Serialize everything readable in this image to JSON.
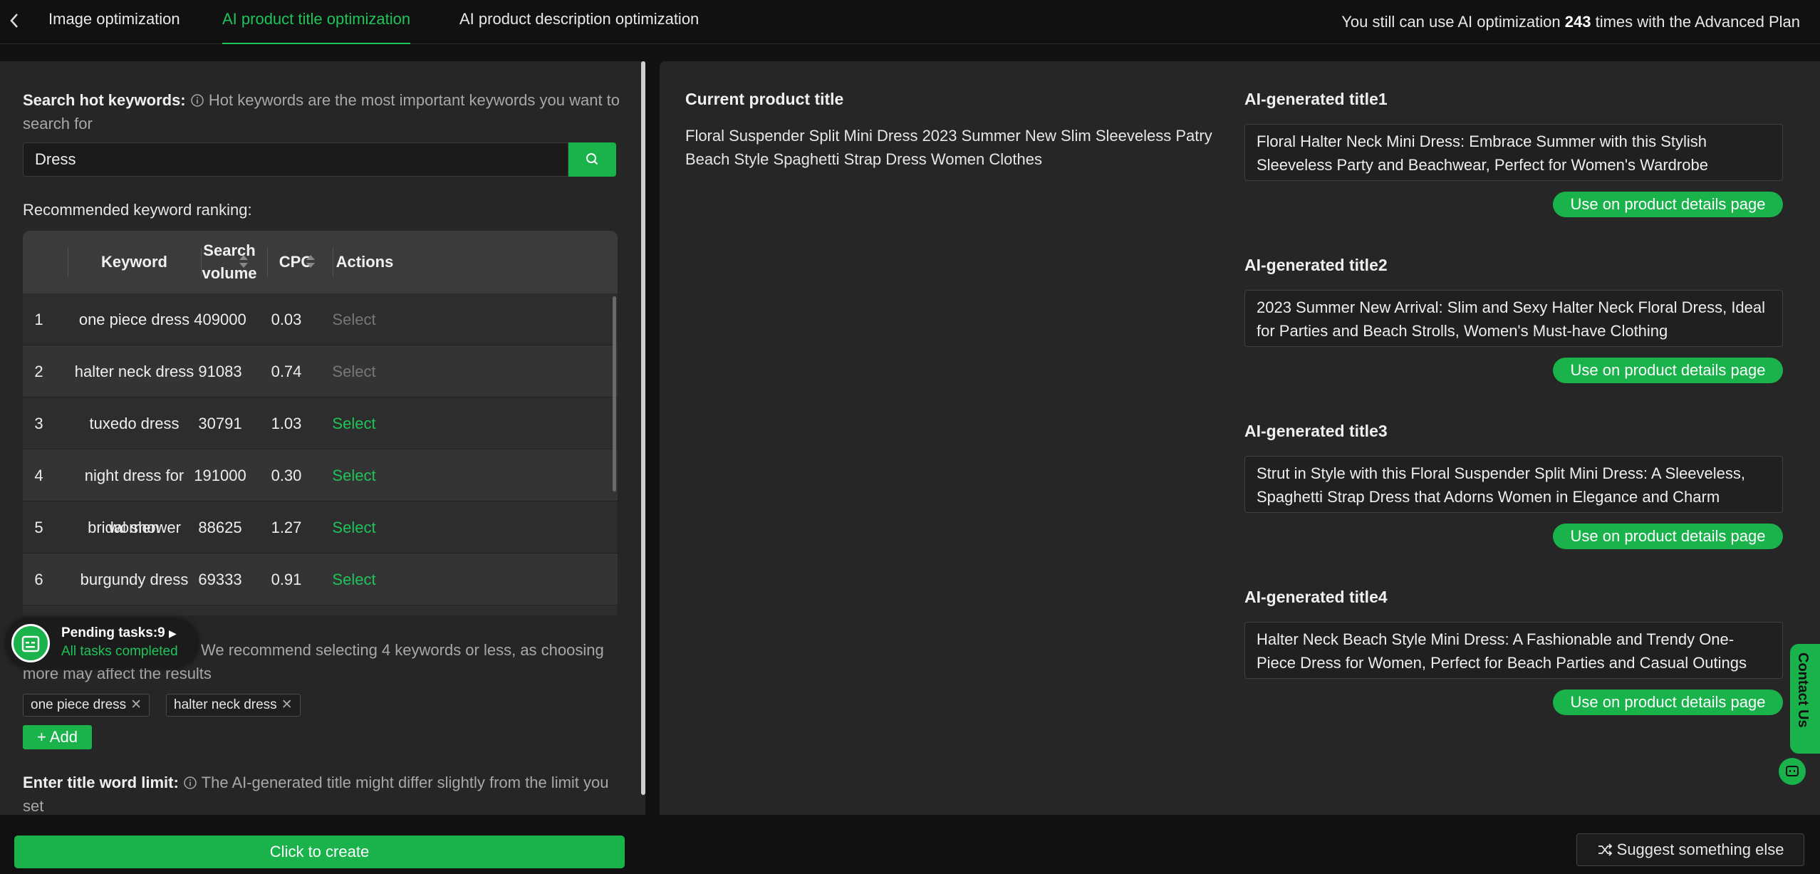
{
  "tabs": [
    {
      "label": "Image optimization"
    },
    {
      "label": "AI product title optimization",
      "active": true
    },
    {
      "label": "AI product description optimization"
    }
  ],
  "quota": {
    "prefix": "You still can use AI optimization",
    "count": "243",
    "suffix": "times with the Advanced Plan"
  },
  "search": {
    "heading": "Search hot keywords:",
    "hint": "Hot keywords are the most important keywords you want to search for",
    "value": "Dress"
  },
  "ranking": {
    "label": "Recommended keyword ranking:",
    "headers": {
      "keyword": "Keyword",
      "volume_line1": "Search",
      "volume_line2": "volume",
      "cpc": "CPC",
      "actions": "Actions"
    },
    "rows": [
      {
        "idx": "1",
        "keyword": "one piece dress",
        "volume": "409000",
        "cpc": "0.03",
        "action": "Select",
        "enabled": false
      },
      {
        "idx": "2",
        "keyword": "halter neck dress",
        "volume": "91083",
        "cpc": "0.74",
        "action": "Select",
        "enabled": false
      },
      {
        "idx": "3",
        "keyword": "tuxedo dress",
        "volume": "30791",
        "cpc": "1.03",
        "action": "Select",
        "enabled": true
      },
      {
        "idx": "4",
        "keyword": "night dress for women",
        "volume": "191000",
        "cpc": "0.30",
        "action": "Select",
        "enabled": true
      },
      {
        "idx": "5",
        "keyword": "bridal shower dress",
        "volume": "88625",
        "cpc": "1.27",
        "action": "Select",
        "enabled": true
      },
      {
        "idx": "6",
        "keyword": "burgundy dress",
        "volume": "69333",
        "cpc": "0.91",
        "action": "Select",
        "enabled": true
      }
    ]
  },
  "pending": {
    "title": "Pending tasks:9",
    "status": "All tasks completed"
  },
  "selection": {
    "note": "We recommend selecting 4 keywords or less, as choosing more may affect the results",
    "chips": [
      "one piece dress",
      "halter neck dress"
    ],
    "add_label": "Add"
  },
  "limit": {
    "heading": "Enter title word limit:",
    "hint": "The AI-generated title might differ slightly from the limit you set"
  },
  "create_label": "Click to create",
  "current": {
    "heading": "Current product title",
    "text": "Floral Suspender Split Mini Dress 2023 Summer New Slim Sleeveless Patry Beach Style Spaghetti Strap Dress Women Clothes"
  },
  "generated": [
    {
      "heading": "AI-generated title1",
      "text": "Floral Halter Neck Mini Dress: Embrace Summer with this Stylish Sleeveless Party and Beachwear, Perfect for Women's Wardrobe",
      "button": "Use on product details page"
    },
    {
      "heading": "AI-generated title2",
      "text": "2023 Summer New Arrival: Slim and Sexy Halter Neck Floral Dress, Ideal for Parties and Beach Strolls, Women's Must-have Clothing",
      "button": "Use on product details page"
    },
    {
      "heading": "AI-generated title3",
      "text": "Strut in Style with this Floral Suspender Split Mini Dress: A Sleeveless, Spaghetti Strap Dress that Adorns Women in Elegance and Charm",
      "button": "Use on product details page"
    },
    {
      "heading": "AI-generated title4",
      "text": "Halter Neck Beach Style Mini Dress: A Fashionable and Trendy One-Piece Dress for Women, Perfect for Beach Parties and Casual Outings",
      "button": "Use on product details page"
    }
  ],
  "contact_label": "Contact Us",
  "suggest_label": "Suggest something else",
  "colors": {
    "accent": "#19b24b",
    "accent_text": "#1fc35a",
    "panel": "#262626",
    "background": "#111111"
  },
  "icons": [
    "chevron-left-icon",
    "info-icon",
    "search-icon",
    "sort-icon",
    "calendar-icon",
    "caret-right-icon",
    "close-icon",
    "plus-icon",
    "shuffle-icon",
    "chat-icon"
  ]
}
